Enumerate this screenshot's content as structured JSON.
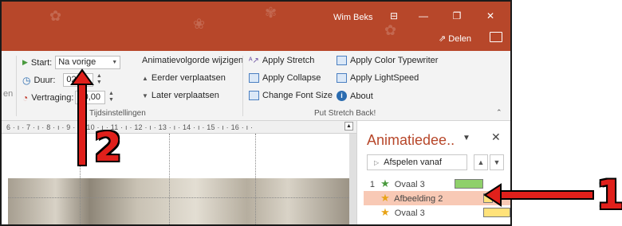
{
  "titlebar": {
    "user": "Wim Beks",
    "share_label": "Delen",
    "bg_color": "#b7472a"
  },
  "ribbon": {
    "timing": {
      "start_label": "Start:",
      "start_value": "Na vorige",
      "duration_label": "Duur:",
      "duration_value": "02,00",
      "delay_label": "Vertraging:",
      "delay_value": "00,00",
      "truncated_left": "en",
      "reorder_title": "Animatievolgorde wijzigen",
      "move_earlier": "Eerder verplaatsen",
      "move_later": "Later verplaatsen",
      "group_label": "Tijdsinstellingen"
    },
    "addin": {
      "apply_stretch": "Apply Stretch",
      "apply_collapse": "Apply Collapse",
      "change_font_size": "Change Font Size",
      "apply_color_typewriter": "Apply Color Typewriter",
      "apply_lightspeed": "Apply LightSpeed",
      "about": "About",
      "group_label": "Put Stretch Back!"
    }
  },
  "ruler": {
    "text": "6 · ı · 7 · ı · 8 · ı · 9 · ı · 10 · ı · 11 · ı · 12 · ı · 13 · ı · 14 · ı · 15 · ı · 16 · ı ·"
  },
  "animation_pane": {
    "title": "Animatiedee..",
    "play_label": "Afspelen vanaf",
    "items": [
      {
        "number": "1",
        "name": "Ovaal 3",
        "selected": false,
        "icon": "green-star-icon"
      },
      {
        "number": "",
        "name": "Afbeelding 2",
        "selected": true,
        "icon": "gold-star-icon"
      },
      {
        "number": "",
        "name": "Ovaal 3",
        "selected": false,
        "icon": "gold-star-icon"
      }
    ]
  },
  "annotations": {
    "marker_1": "1",
    "marker_2": "2",
    "color": "#e0201b"
  }
}
